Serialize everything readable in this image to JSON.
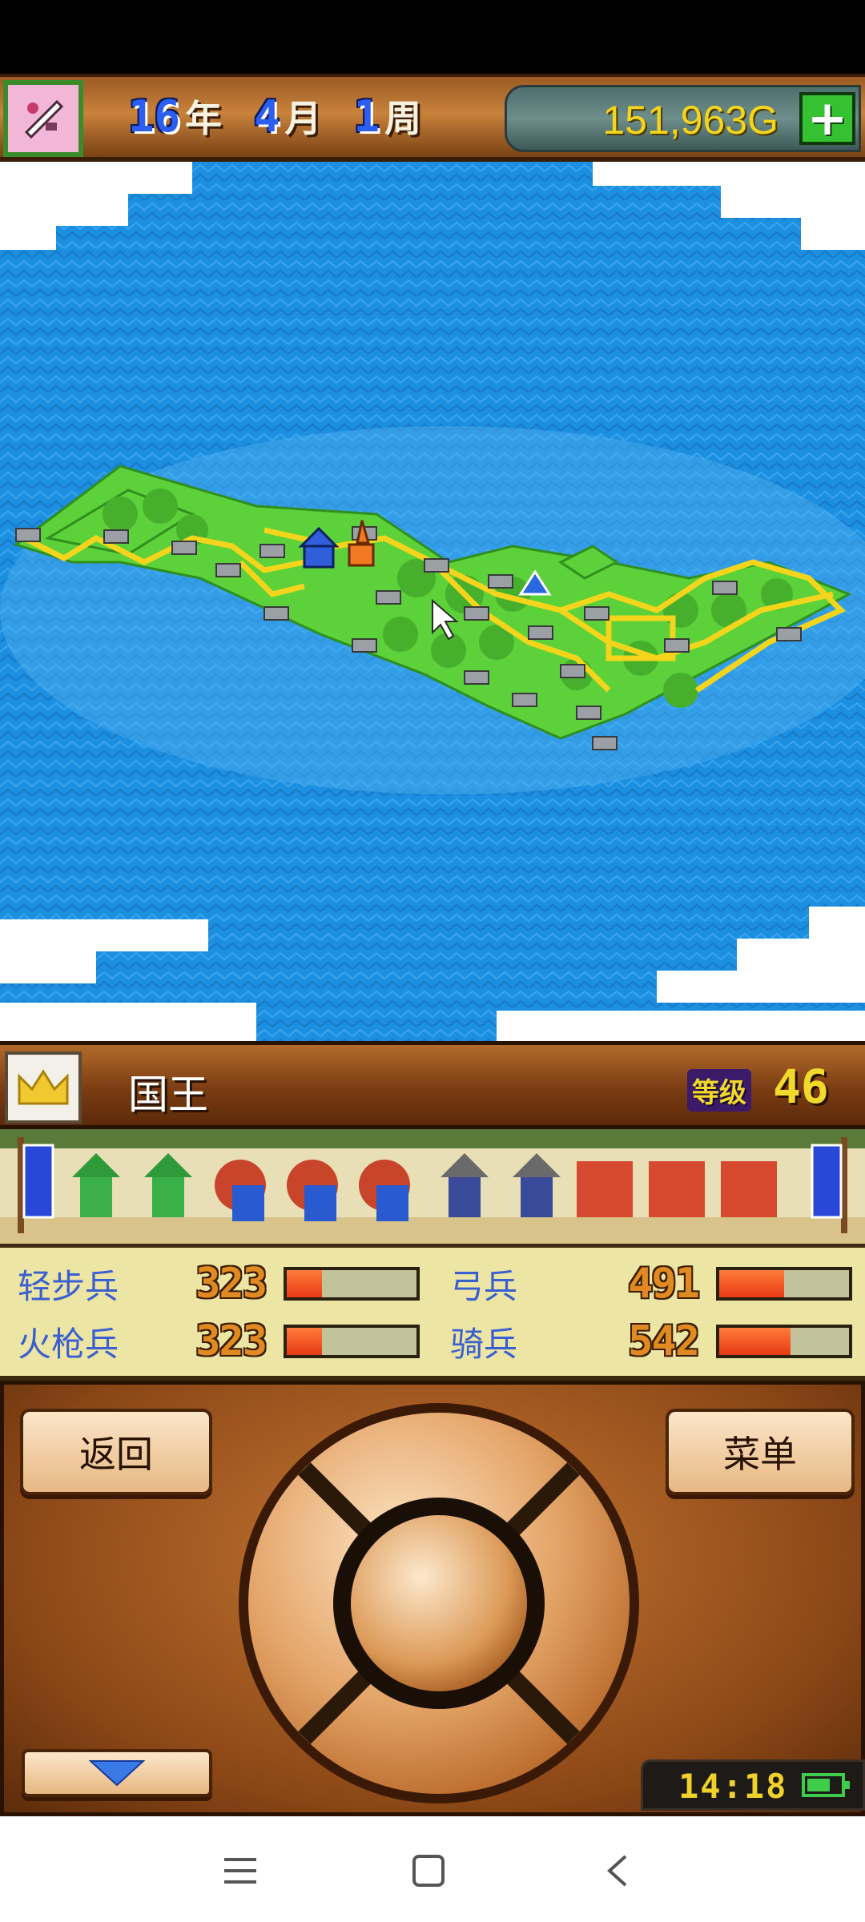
{
  "top_bar": {
    "year": "16",
    "year_unit": "年",
    "month": "4",
    "month_unit": "月",
    "week": "1",
    "week_unit": "周",
    "gold": "151,963G",
    "add_gold_icon": "plus-icon"
  },
  "king_panel": {
    "title": "国王",
    "level_label": "等级",
    "level": "46"
  },
  "troop_stats": [
    {
      "name": "轻步兵",
      "value": "323",
      "fill": 0.27
    },
    {
      "name": "弓兵",
      "value": "491",
      "fill": 0.5
    },
    {
      "name": "火枪兵",
      "value": "323",
      "fill": 0.27
    },
    {
      "name": "骑兵",
      "value": "542",
      "fill": 0.55
    }
  ],
  "controls": {
    "back_label": "返回",
    "menu_label": "菜单",
    "down_icon": "triangle-down-icon"
  },
  "clock": {
    "time": "14:18",
    "battery_icon": "battery-icon"
  },
  "colors": {
    "sea": "#1d8fe0",
    "land": "#5cd13a",
    "road": "#f4d51c",
    "gold_text": "#f4d51c",
    "troop_label": "#3a5fd0"
  },
  "android_nav": {
    "icons": [
      "menu-icon",
      "home-icon",
      "back-icon"
    ]
  }
}
